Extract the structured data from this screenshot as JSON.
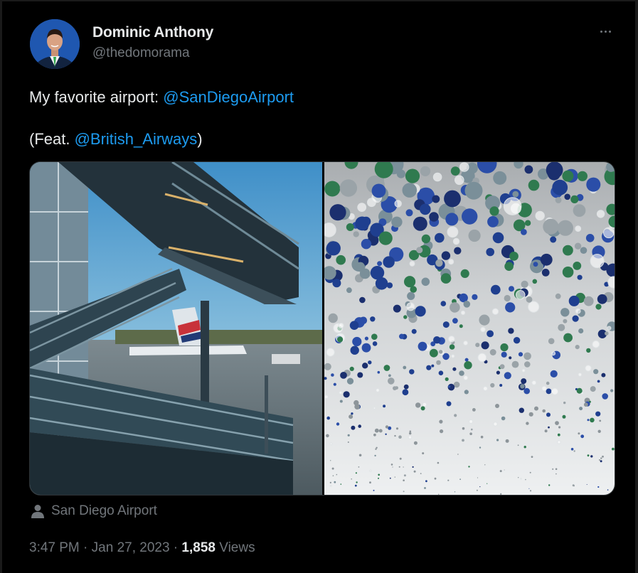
{
  "author": {
    "name": "Dominic Anthony",
    "handle": "@thedomorama"
  },
  "tweet": {
    "line1_text": "My favorite airport: ",
    "line1_mention": "@SanDiegoAirport",
    "line2_prefix": "(Feat. ",
    "line2_mention": "@British_Airways",
    "line2_suffix": ")"
  },
  "media": {
    "left_image": "airport stairs and British Airways plane tail photo",
    "right_image": "hanging glass and blue disc art installation photo"
  },
  "location": {
    "label": "San Diego Airport",
    "icon": "person-icon"
  },
  "meta": {
    "time": "3:47 PM",
    "separator": " · ",
    "date": "Jan 27, 2023",
    "views_count": "1,858",
    "views_label": " Views"
  },
  "icons": {
    "more": "more-options-icon",
    "avatar": "avatar-image"
  },
  "colors": {
    "background": "#000000",
    "text": "#e7e9ea",
    "secondary": "#71767b",
    "link": "#1d9bf0"
  }
}
